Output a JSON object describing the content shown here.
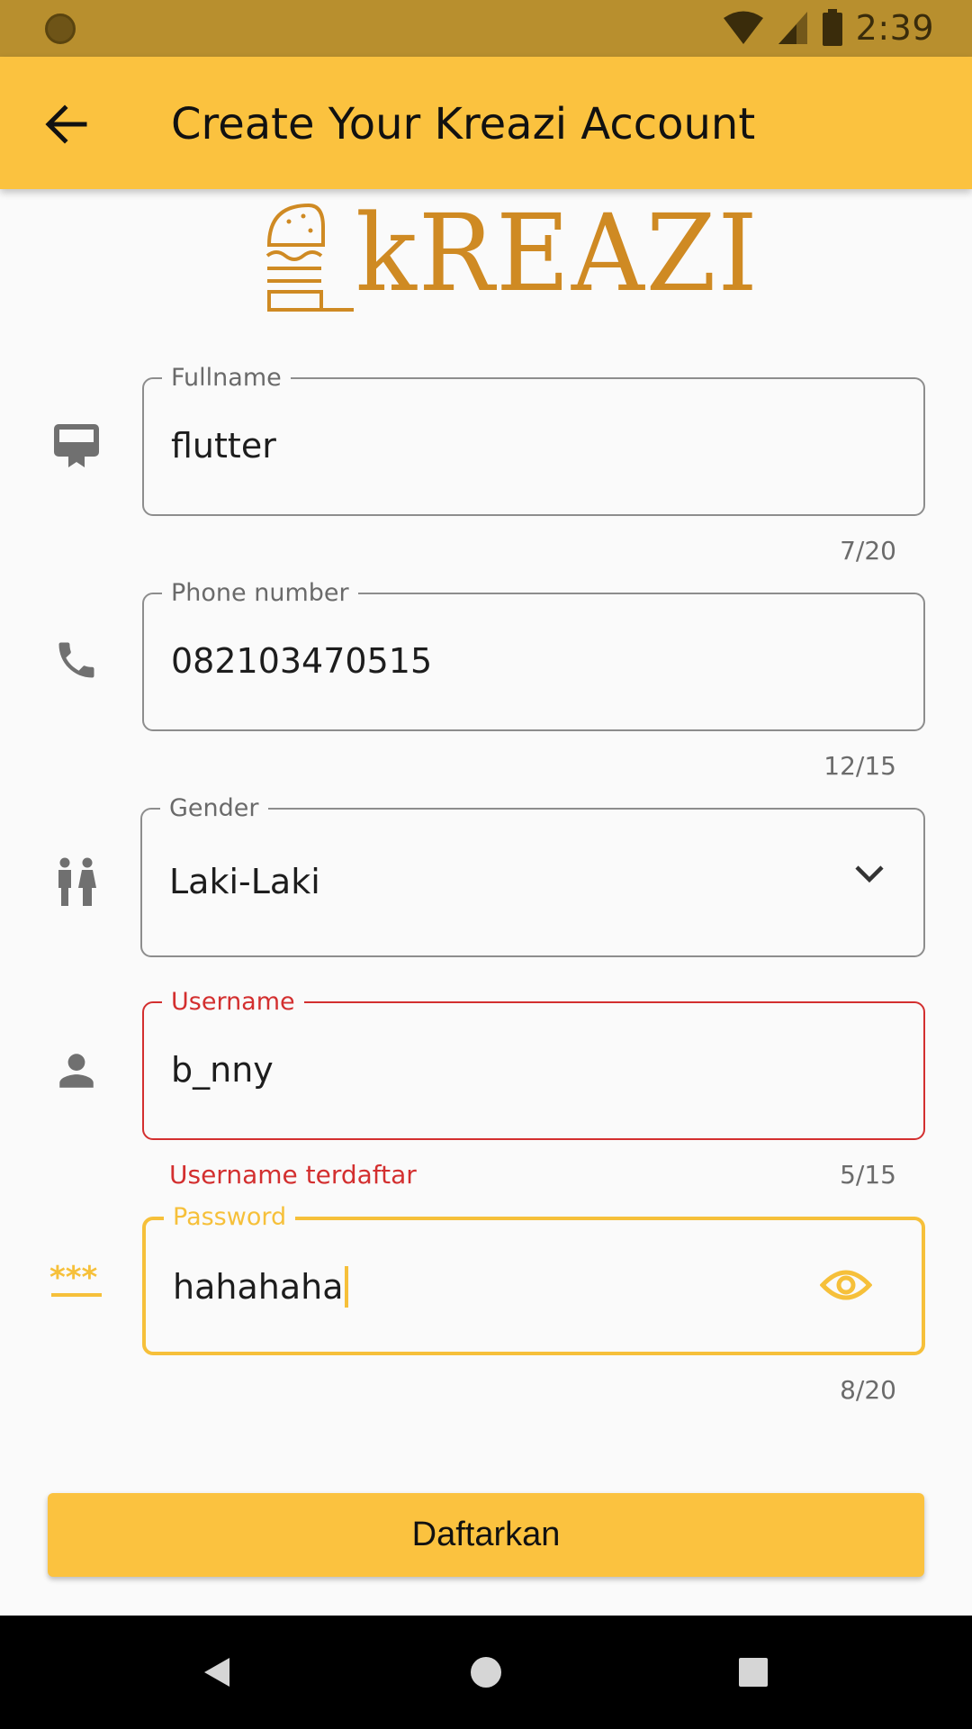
{
  "status_bar": {
    "time": "2:39"
  },
  "app_bar": {
    "title": "Create Your Kreazi Account",
    "back_icon": "arrow-back-icon"
  },
  "logo": {
    "text": "kREAZI"
  },
  "form": {
    "fullname": {
      "label": "Fullname",
      "value": "flutter",
      "counter": "7/20",
      "icon": "card-icon"
    },
    "phone": {
      "label": "Phone number",
      "value": "082103470515",
      "counter": "12/15",
      "icon": "phone-icon"
    },
    "gender": {
      "label": "Gender",
      "value": "Laki-Laki",
      "icon": "wc-icon"
    },
    "username": {
      "label": "Username",
      "value": "b_nny",
      "counter": "5/15",
      "error": "Username terdaftar",
      "icon": "person-icon"
    },
    "password": {
      "label": "Password",
      "value": "hahahaha",
      "counter": "8/20",
      "icon": "password-icon"
    }
  },
  "submit": {
    "label": "Daftarkan"
  },
  "colors": {
    "accent": "#fbc23f",
    "error": "#d32f2f",
    "status_bar": "#b88f2e",
    "logo": "#cf8a23"
  }
}
